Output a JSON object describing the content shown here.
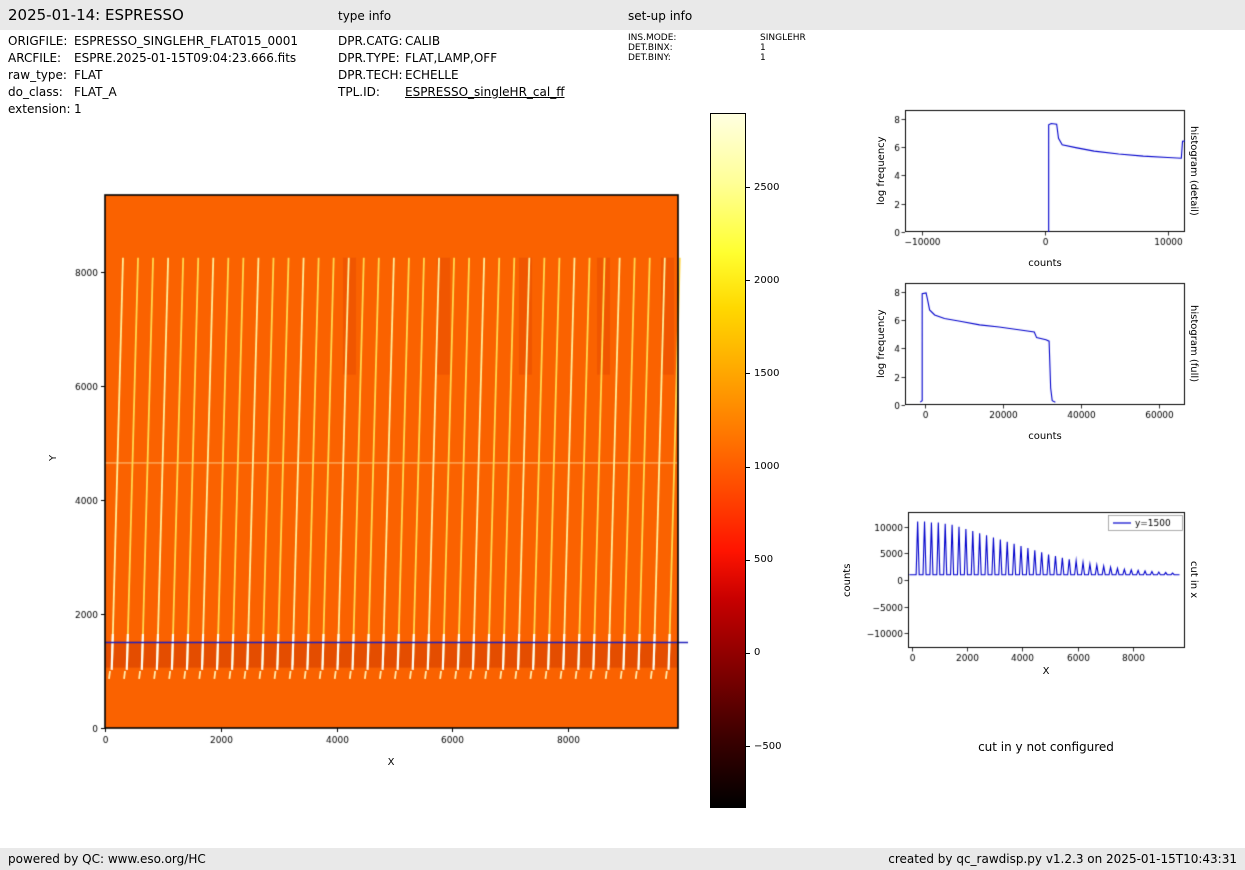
{
  "header": {
    "title": "2025-01-14: ESPRESSO",
    "type_info_label": "type info",
    "setup_info_label": "set-up info"
  },
  "file_info": {
    "rows": [
      {
        "label": "ORIGFILE:",
        "value": "ESPRESSO_SINGLEHR_FLAT015_0001"
      },
      {
        "label": "ARCFILE:",
        "value": "ESPRE.2025-01-15T09:04:23.666.fits"
      },
      {
        "label": "raw_type:",
        "value": "FLAT"
      },
      {
        "label": "do_class:",
        "value": "FLAT_A"
      },
      {
        "label": "extension:",
        "value": "1"
      }
    ]
  },
  "type_info": {
    "rows": [
      {
        "label": "DPR.CATG:",
        "value": "CALIB"
      },
      {
        "label": "DPR.TYPE:",
        "value": "FLAT,LAMP,OFF"
      },
      {
        "label": "DPR.TECH:",
        "value": "ECHELLE"
      },
      {
        "label": "TPL.ID:",
        "value": "ESPRESSO_singleHR_cal_ff"
      }
    ]
  },
  "setup_info": {
    "rows": [
      {
        "label": "INS.MODE:",
        "value": "SINGLEHR"
      },
      {
        "label": "DET.BINX:",
        "value": "1"
      },
      {
        "label": "DET.BINY:",
        "value": "1"
      }
    ]
  },
  "cut_y_note": "cut in y not configured",
  "footer": {
    "left": "powered by QC: www.eso.org/HC",
    "right": "created by qc_rawdisp.py v1.2.3 on 2025-01-15T10:43:31"
  },
  "chart_data": [
    {
      "id": "raw_image",
      "type": "heatmap",
      "xlabel": "X",
      "ylabel": "Y",
      "xlim": [
        0,
        9900
      ],
      "ylim": [
        0,
        9350
      ],
      "xticks": [
        0,
        2000,
        4000,
        6000,
        8000
      ],
      "yticks": [
        0,
        2000,
        4000,
        6000,
        8000
      ],
      "background_counts": 1000,
      "background_color": "#fa6200",
      "n_order_stripes": 38,
      "stripes_y_range": [
        1000,
        8250
      ],
      "stripe_peak_counts": 2800,
      "cut_line_y": 1500,
      "cut_line_color": "#2323bb",
      "colorbar": {
        "vmin": -830,
        "vmax": 2900,
        "ticks": [
          -500,
          0,
          500,
          1000,
          1500,
          2000,
          2500
        ],
        "colormap": "hot",
        "stops": [
          {
            "pos": 0.0,
            "color": "#000000"
          },
          {
            "pos": 0.1,
            "color": "#3c0000"
          },
          {
            "pos": 0.2,
            "color": "#820000"
          },
          {
            "pos": 0.3,
            "color": "#c80000"
          },
          {
            "pos": 0.37,
            "color": "#ff1400"
          },
          {
            "pos": 0.46,
            "color": "#ff4b00"
          },
          {
            "pos": 0.55,
            "color": "#ff7e00"
          },
          {
            "pos": 0.64,
            "color": "#ffae00"
          },
          {
            "pos": 0.72,
            "color": "#ffd800"
          },
          {
            "pos": 0.8,
            "color": "#ffff30"
          },
          {
            "pos": 0.9,
            "color": "#ffff96"
          },
          {
            "pos": 1.0,
            "color": "#ffffe0"
          }
        ]
      }
    },
    {
      "id": "hist_detail",
      "type": "line",
      "side_label": "histogram (detail)",
      "xlabel": "counts",
      "ylabel": "log frequency",
      "xlim": [
        -11400,
        11400
      ],
      "ylim": [
        0,
        8.6
      ],
      "xticks": [
        -10000,
        0,
        10000
      ],
      "yticks": [
        0,
        2,
        4,
        6,
        8
      ],
      "color": "#0000cc",
      "points": [
        [
          300,
          0
        ],
        [
          300,
          7.55
        ],
        [
          500,
          7.65
        ],
        [
          950,
          7.6
        ],
        [
          1100,
          6.6
        ],
        [
          1400,
          6.15
        ],
        [
          2500,
          5.95
        ],
        [
          4000,
          5.7
        ],
        [
          6000,
          5.5
        ],
        [
          8000,
          5.35
        ],
        [
          10000,
          5.25
        ],
        [
          11100,
          5.2
        ],
        [
          11200,
          6.4
        ],
        [
          11400,
          6.42
        ]
      ]
    },
    {
      "id": "hist_full",
      "type": "line",
      "side_label": "histogram (full)",
      "xlabel": "counts",
      "ylabel": "log frequency",
      "xlim": [
        -5100,
        66600
      ],
      "ylim": [
        0,
        8.6
      ],
      "xticks": [
        0,
        20000,
        40000,
        60000
      ],
      "yticks": [
        0,
        2,
        4,
        6,
        8
      ],
      "color": "#0000cc",
      "points": [
        [
          -1200,
          0.2
        ],
        [
          -700,
          0.3
        ],
        [
          -700,
          7.85
        ],
        [
          300,
          7.9
        ],
        [
          700,
          7.4
        ],
        [
          1200,
          6.7
        ],
        [
          2500,
          6.35
        ],
        [
          5000,
          6.1
        ],
        [
          9000,
          5.9
        ],
        [
          14000,
          5.65
        ],
        [
          19000,
          5.5
        ],
        [
          24000,
          5.3
        ],
        [
          28000,
          5.15
        ],
        [
          28600,
          4.75
        ],
        [
          31000,
          4.6
        ],
        [
          31800,
          4.5
        ],
        [
          32200,
          1.2
        ],
        [
          32600,
          0.3
        ],
        [
          33400,
          0.2
        ]
      ]
    },
    {
      "id": "cut_x",
      "type": "line",
      "side_label": "cut in x",
      "xlabel": "X",
      "ylabel": "counts",
      "legend": "y=1500",
      "xlim": [
        -150,
        9900
      ],
      "ylim": [
        -12800,
        12800
      ],
      "xticks": [
        0,
        2000,
        4000,
        6000,
        8000
      ],
      "yticks": [
        -10000,
        -5000,
        0,
        5000,
        10000
      ],
      "color": "#0000cc",
      "baseline": 1000,
      "peak_positions_start": 200,
      "peak_spacing": 250,
      "peak_heights": [
        11000,
        11000,
        10800,
        10800,
        10600,
        10400,
        10000,
        9600,
        9200,
        8800,
        8400,
        8000,
        7600,
        7200,
        6800,
        6400,
        6000,
        5600,
        5200,
        4800,
        4500,
        4200,
        3900,
        3600,
        3300,
        3000,
        2800,
        2600,
        2400,
        2200,
        2000,
        1900,
        1800,
        1700,
        1600,
        1500,
        1400,
        1300
      ]
    }
  ]
}
